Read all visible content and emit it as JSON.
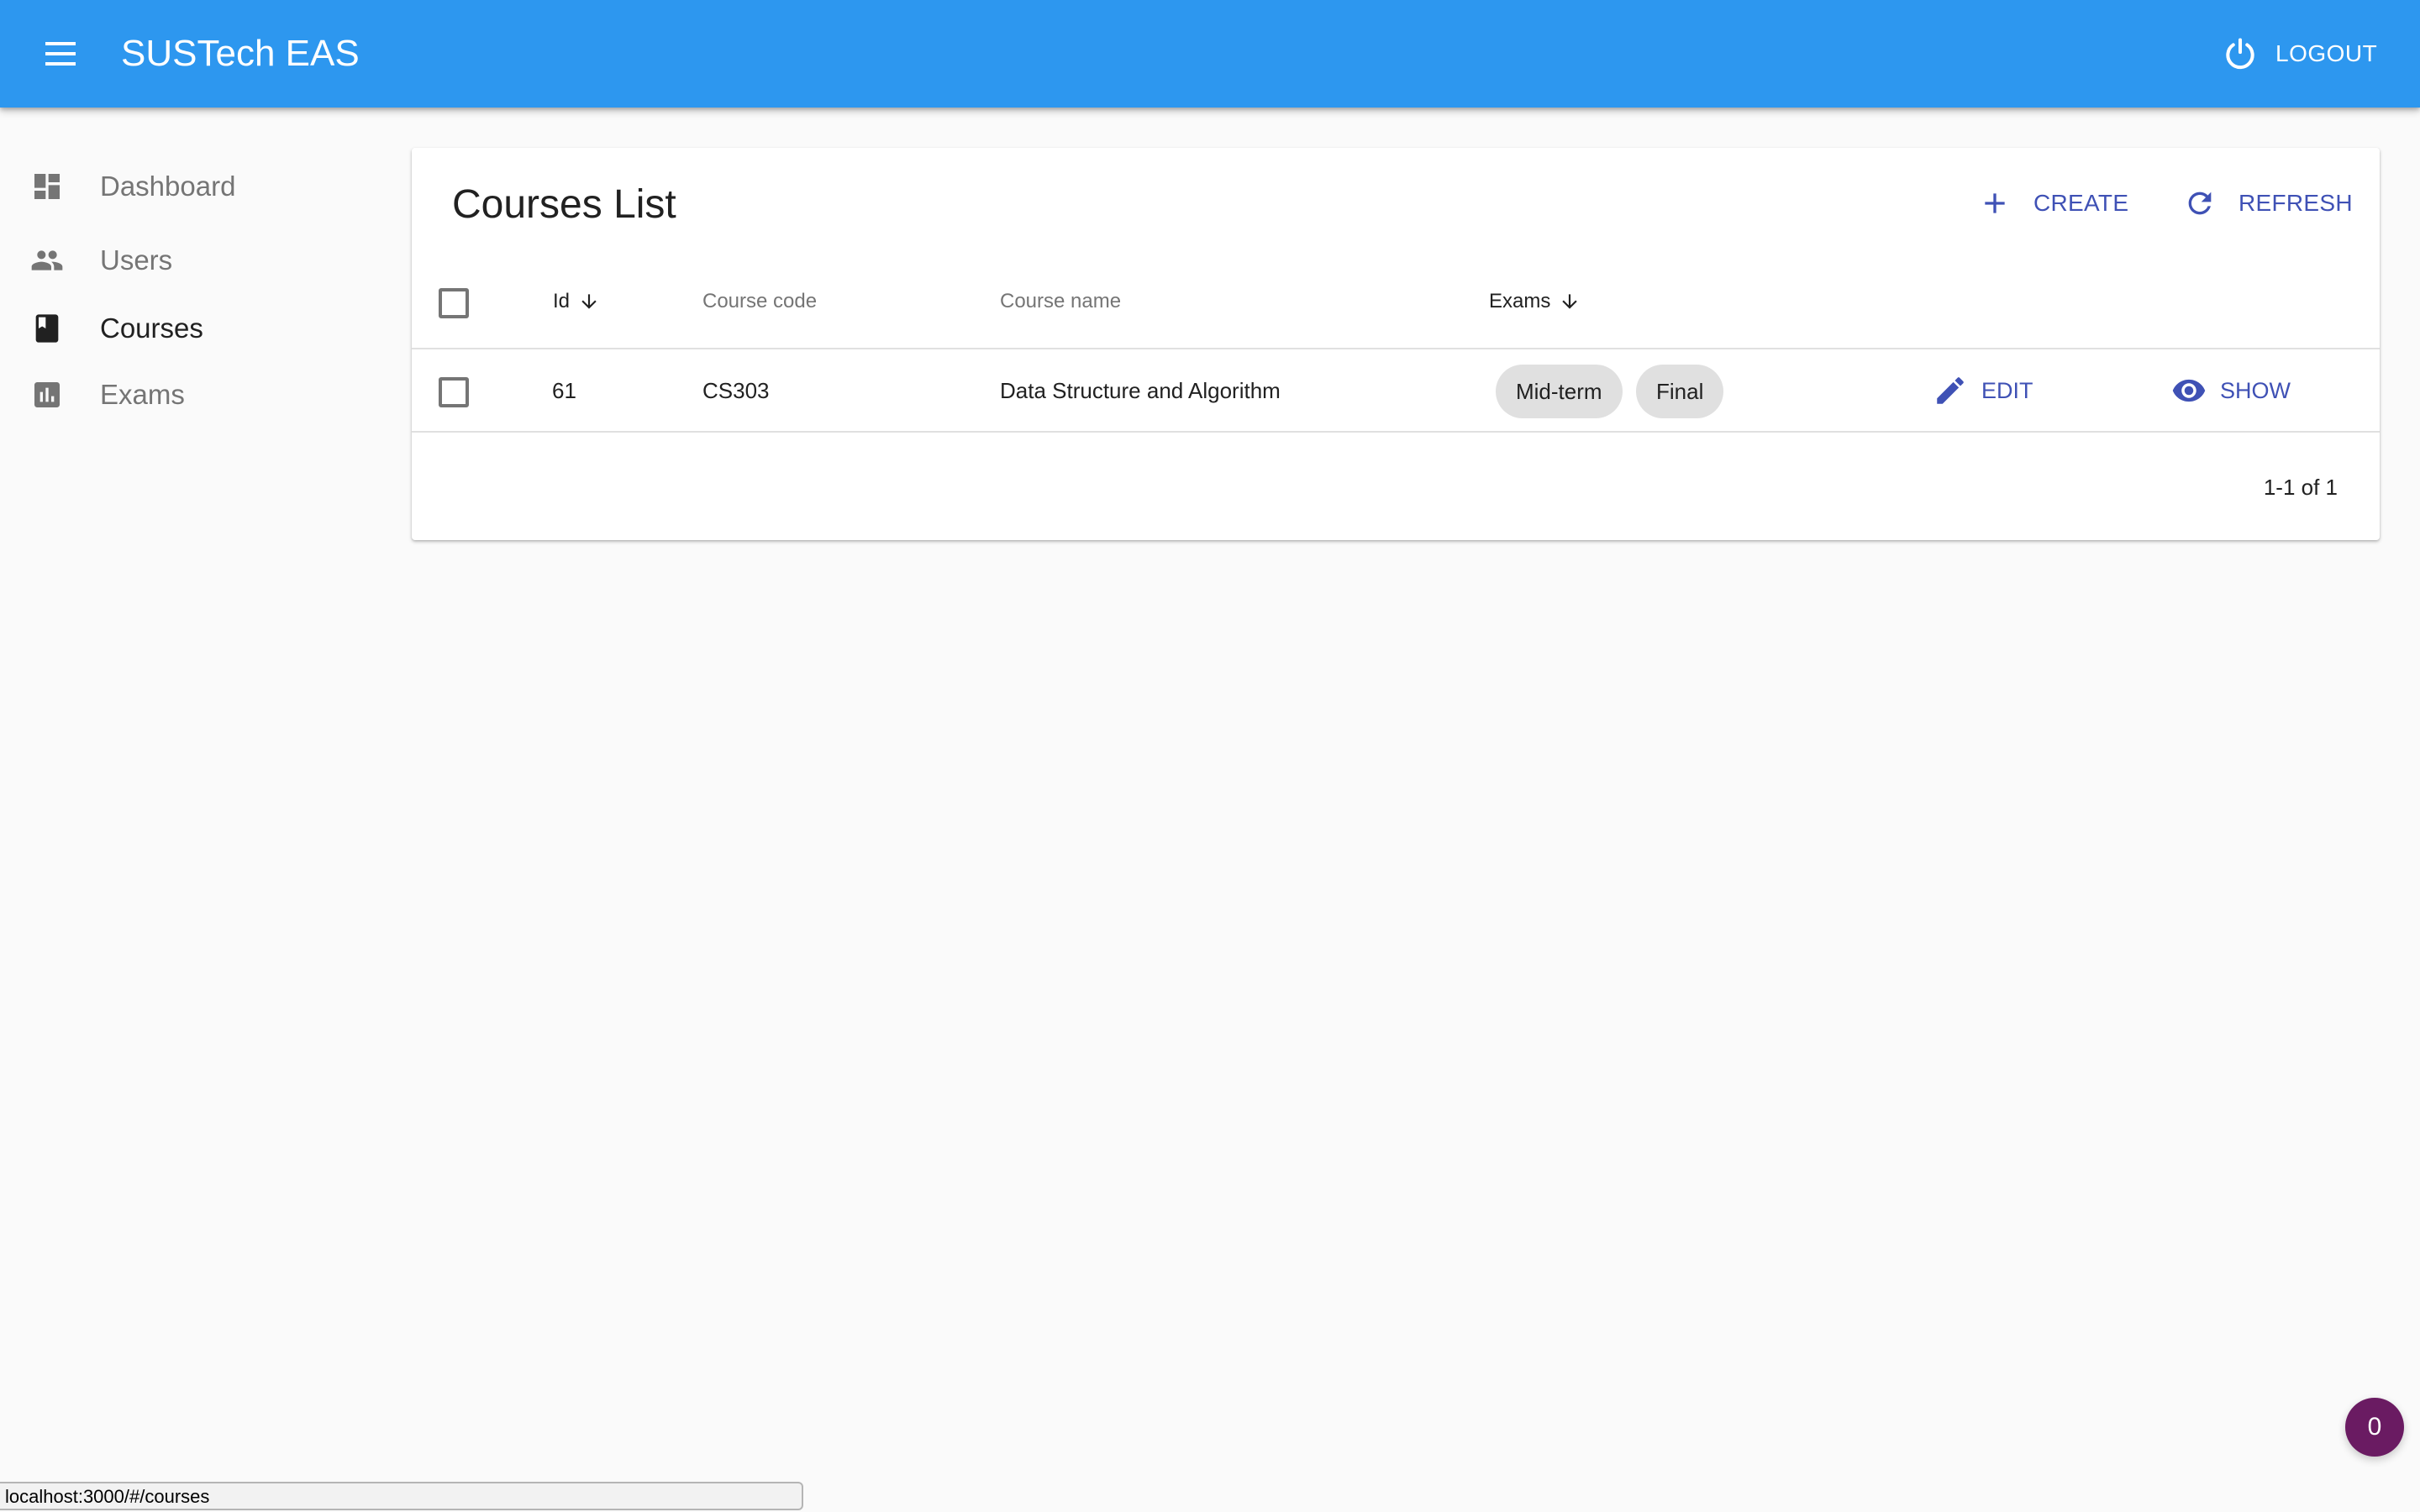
{
  "app": {
    "title": "SUSTech EAS",
    "logout_label": "LOGOUT"
  },
  "sidebar": {
    "items": [
      {
        "label": "Dashboard",
        "icon": "dashboard-icon",
        "active": false
      },
      {
        "label": "Users",
        "icon": "people-icon",
        "active": false
      },
      {
        "label": "Courses",
        "icon": "book-icon",
        "active": true
      },
      {
        "label": "Exams",
        "icon": "bar-chart-icon",
        "active": false
      }
    ]
  },
  "main": {
    "title": "Courses List",
    "create_label": "CREATE",
    "refresh_label": "REFRESH",
    "columns": [
      {
        "label": "Id",
        "sortable": true
      },
      {
        "label": "Course code",
        "sortable": false
      },
      {
        "label": "Course name",
        "sortable": false
      },
      {
        "label": "Exams",
        "sortable": true
      }
    ],
    "rows": [
      {
        "id": "61",
        "course_code": "CS303",
        "course_name": "Data Structure and Algorithm",
        "exams": [
          "Mid-term",
          "Final"
        ],
        "edit_label": "EDIT",
        "show_label": "SHOW"
      }
    ],
    "pagination": "1-1 of 1"
  },
  "notification": {
    "count": "0"
  },
  "status_bar": {
    "url": "localhost:3000/#/courses"
  },
  "colors": {
    "appbar": "#2d97ef",
    "accent": "#3f51b5",
    "chip": "#e0e0e0",
    "notification": "#6a1b62"
  }
}
